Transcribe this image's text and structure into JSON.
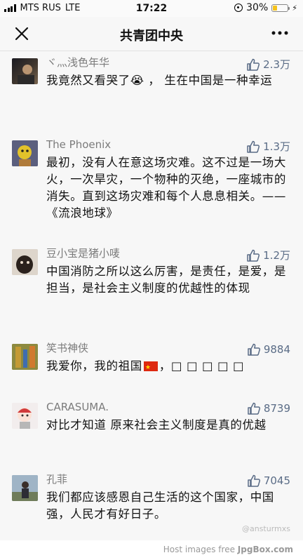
{
  "status_bar": {
    "carrier": "MTS RUS",
    "network": "LTE",
    "time": "17:22",
    "battery": "30%",
    "battery_level": 0.3
  },
  "nav": {
    "title": "共青团中央"
  },
  "comments": [
    {
      "name": "ヾ灬浅色年华",
      "likes": "2.3万",
      "text": "我竟然又看哭了😭 ， 生在中国是一种幸运"
    },
    {
      "name": "The Phoenix",
      "likes": "1.3万",
      "text": "最初，没有人在意这场灾难。这不过是一场大火，一次旱灾，一个物种的灭绝，一座城市的消失。直到这场灾难和每个人息息相关。——《流浪地球》"
    },
    {
      "name": "豆小宝是猪小唛",
      "likes": "1.2万",
      "text": "中国消防之所以这么厉害，是责任，是爱，是担当，是社会主义制度的优越性的体现"
    },
    {
      "name": "笑书神侠",
      "likes": "9884",
      "text_before_flag": "我爱你，我的祖国",
      "text_after_flag": "，□ □ □ □ □"
    },
    {
      "name": "CARASUMA.",
      "likes": "8739",
      "text": "对比才知道 原来社会主义制度是真的优越"
    },
    {
      "name": "孔菲",
      "likes": "7045",
      "text": "我们都应该感恩自己生活的这个国家，中国强，人民才有好日子。"
    }
  ],
  "watermark": "@ansturmxs",
  "footer": {
    "text": "Host images free",
    "brand": "JpgBox.com"
  }
}
